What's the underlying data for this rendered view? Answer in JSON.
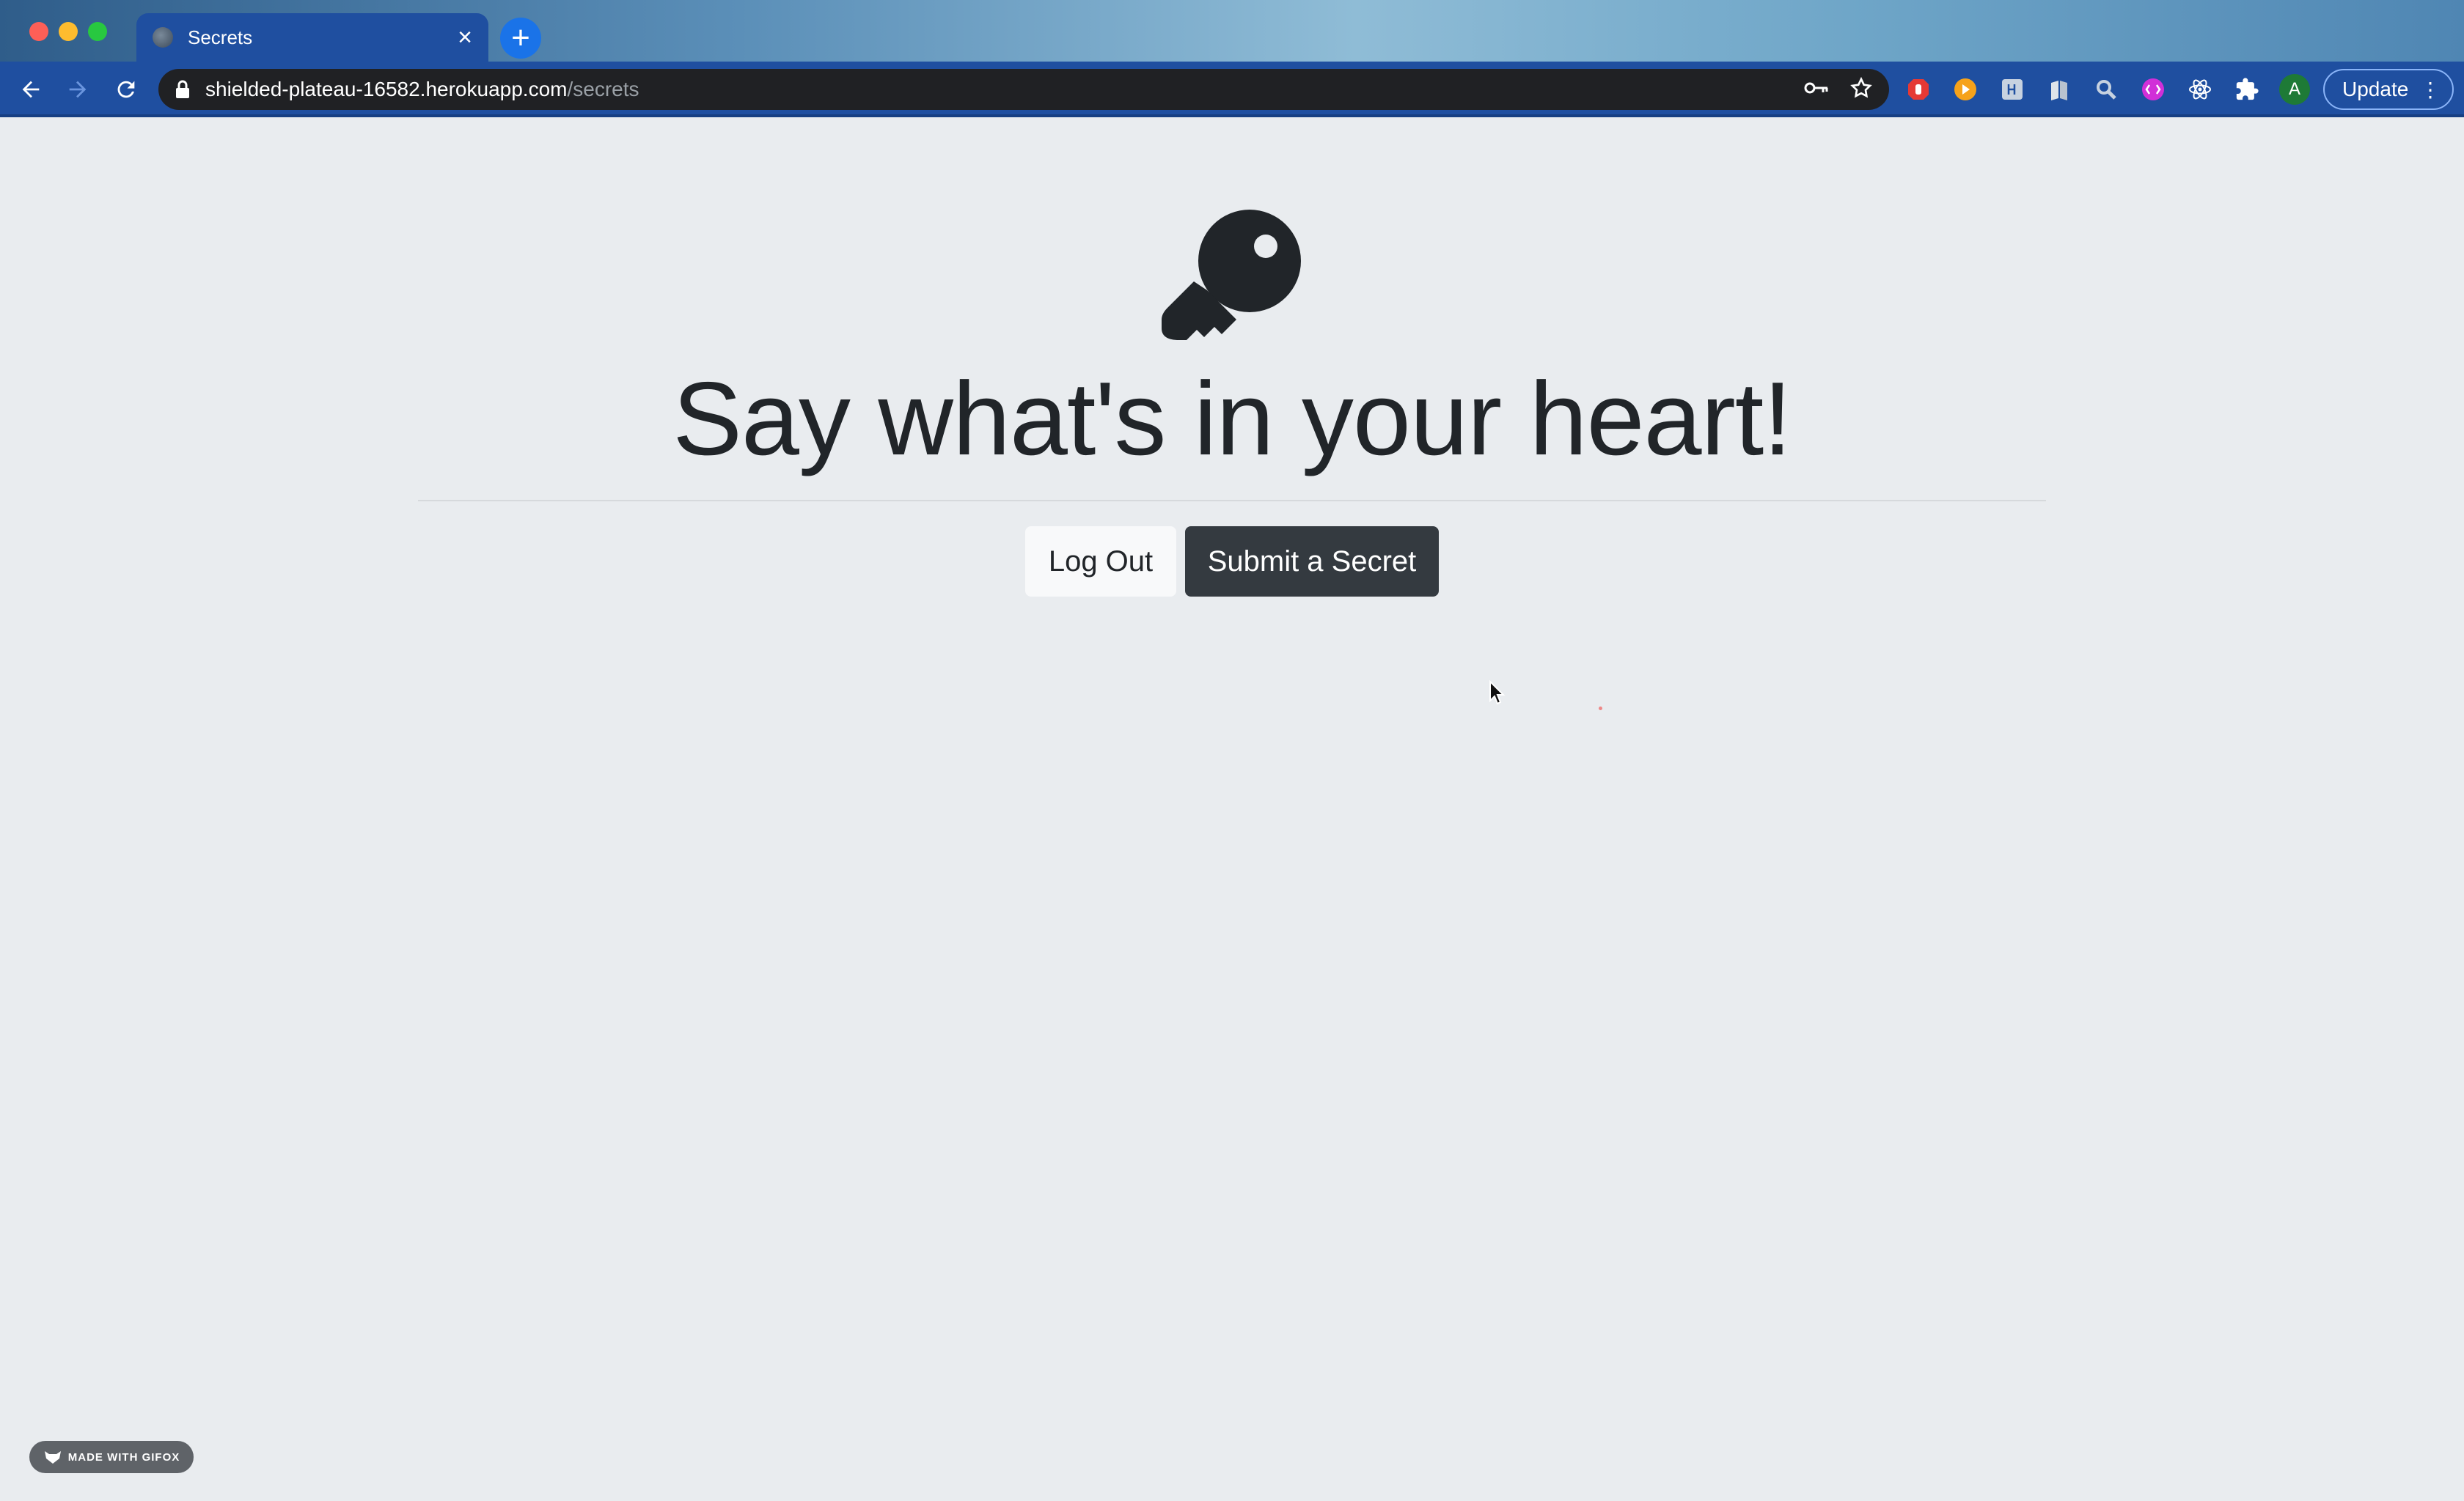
{
  "browser": {
    "tab_title": "Secrets",
    "tab_close": "×",
    "new_tab": "+",
    "url_host": "shielded-plateau-16582.herokuapp.com",
    "url_path": "/secrets",
    "profile_initial": "A",
    "update_label": "Update",
    "update_menu": "⋮"
  },
  "page": {
    "heading": "Say what's in your heart!",
    "logout_label": "Log Out",
    "submit_label": "Submit a Secret"
  },
  "watermark": {
    "label": "MADE WITH GIFOX"
  }
}
